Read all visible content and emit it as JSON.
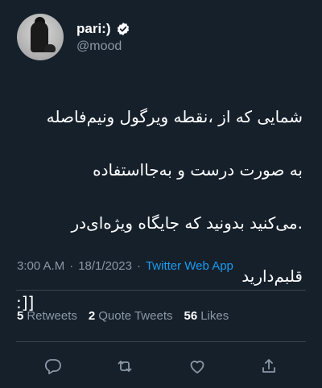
{
  "author": {
    "display_name": "pari:)",
    "handle": "@mood",
    "verified_icon": "verified-badge-icon",
    "avatar_icon": "profile-photo"
  },
  "tweet": {
    "text_lines": [
      "شمایی که از ،نقطه ویرگول ونیم‌فاصله",
      "به صورت درست و به‌جااستفاده",
      ".می‌کنید بدونید که جایگاه ویژه‌ای‌در",
      "قلبم‌دارید"
    ],
    "emoticon": ":]]"
  },
  "meta": {
    "time": "3:00 A.M",
    "date": "18/1/2023",
    "separator": "·",
    "source": "Twitter Web App"
  },
  "stats": {
    "retweets_count": "5",
    "retweets_label": "Retweets",
    "quotes_count": "2",
    "quotes_label": "Quote Tweets",
    "likes_count": "56",
    "likes_label": "Likes"
  },
  "actions": [
    "reply-icon",
    "retweet-icon",
    "like-icon",
    "share-icon"
  ],
  "colors": {
    "background": "#15202b",
    "text": "#ffffff",
    "muted": "#8b98a5",
    "accent": "#1d9bf0",
    "divider": "#38444d"
  }
}
